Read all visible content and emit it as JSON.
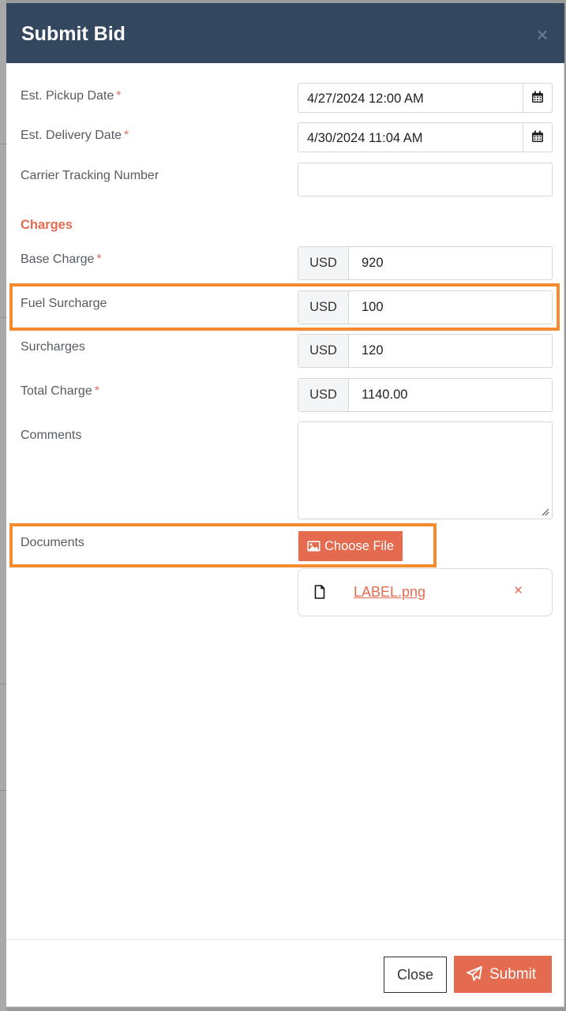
{
  "modal": {
    "title": "Submit Bid",
    "close_glyph": "×"
  },
  "fields": {
    "pickup": {
      "label": "Est. Pickup Date",
      "required": "*",
      "value": "4/27/2024 12:00 AM",
      "icon": "calendar-icon"
    },
    "delivery": {
      "label": "Est. Delivery Date",
      "required": "*",
      "value": "4/30/2024 11:04 AM",
      "icon": "calendar-icon"
    },
    "tracking": {
      "label": "Carrier Tracking Number",
      "value": ""
    }
  },
  "charges": {
    "title": "Charges",
    "base": {
      "label": "Base Charge",
      "required": "*",
      "currency": "USD",
      "value": "920"
    },
    "fuel": {
      "label": "Fuel Surcharge",
      "currency": "USD",
      "value": "100"
    },
    "surcharges": {
      "label": "Surcharges",
      "currency": "USD",
      "value": "120"
    },
    "total": {
      "label": "Total Charge",
      "required": "*",
      "currency": "USD",
      "value": "1140.00"
    }
  },
  "comments": {
    "label": "Comments",
    "value": ""
  },
  "documents": {
    "label": "Documents",
    "choose_label": "Choose File",
    "choose_icon": "image-icon",
    "file": {
      "name": "LABEL.png",
      "icon": "file-icon",
      "remove_glyph": "×"
    }
  },
  "footer": {
    "close_label": "Close",
    "submit_label": "Submit",
    "submit_icon": "paper-plane-icon"
  },
  "colors": {
    "header_bg": "#33475e",
    "accent": "#e46b4f",
    "highlight": "#f58a2f",
    "required": "#e07162"
  }
}
